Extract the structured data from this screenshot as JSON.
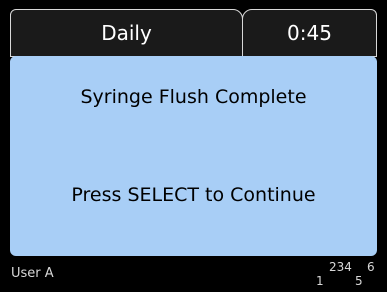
{
  "header": {
    "mode_tab": "Daily",
    "time_tab": "0:45"
  },
  "message": {
    "line1": "Syringe Flush Complete",
    "line2": "Press SELECT to Continue"
  },
  "footer": {
    "user": "User A",
    "indicators_top": "234",
    "indicator_6": "6",
    "indicator_1": "1",
    "indicator_5": "5"
  },
  "colors": {
    "background": "#000000",
    "panel": "#a8cef6",
    "tab_fill": "#1a1a1a",
    "border": "#d8d8d8"
  }
}
